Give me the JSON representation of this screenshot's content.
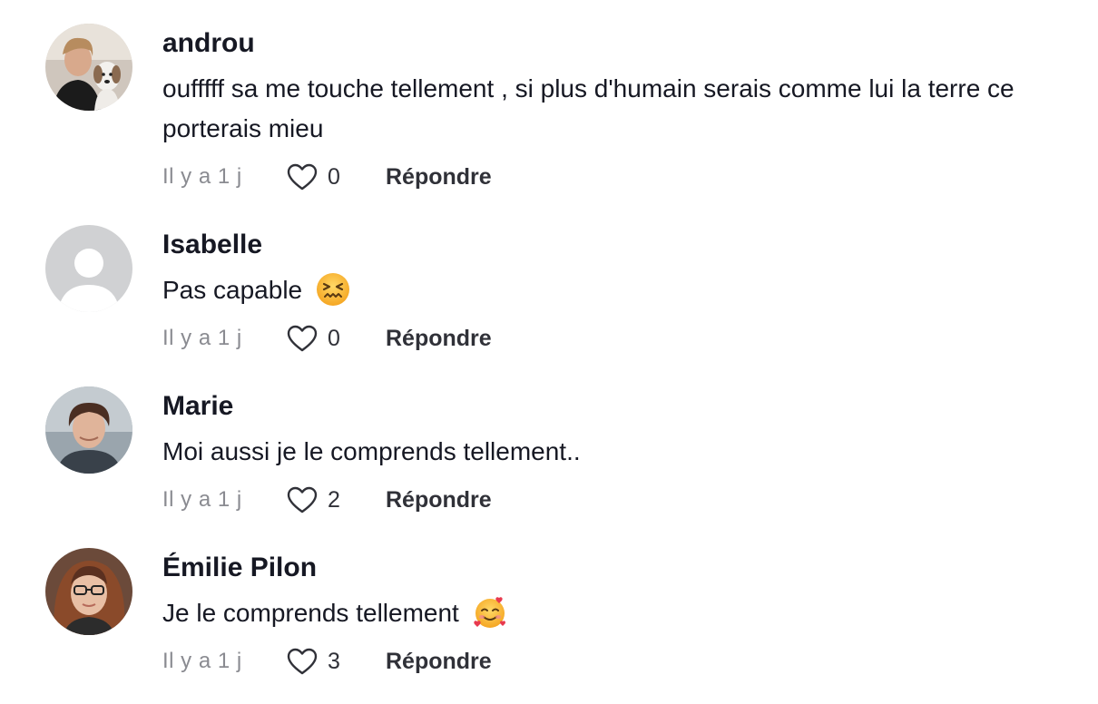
{
  "comments": [
    {
      "username": "androu",
      "text": "oufffff sa me touche tellement , si plus d'humain serais comme lui la terre ce porterais mieu",
      "time": "Il y a 1 j",
      "likes": "0",
      "reply_label": "Répondre"
    },
    {
      "username": "Isabelle",
      "text": "Pas capable",
      "emoji": "confounded-face",
      "time": "Il y a 1 j",
      "likes": "0",
      "reply_label": "Répondre"
    },
    {
      "username": "Marie",
      "text": "Moi aussi je le comprends tellement..",
      "time": "Il y a 1 j",
      "likes": "2",
      "reply_label": "Répondre"
    },
    {
      "username": "Émilie Pilon",
      "text": "Je le comprends tellement",
      "emoji": "smiling-face-with-hearts",
      "time": "Il y a 1 j",
      "likes": "3",
      "reply_label": "Répondre"
    }
  ],
  "icons": {
    "like": "heart-outline-icon",
    "default_avatar": "user-silhouette-icon"
  },
  "colors": {
    "username": "#161823",
    "meta": "#8a8b91",
    "heart": "#303138"
  }
}
